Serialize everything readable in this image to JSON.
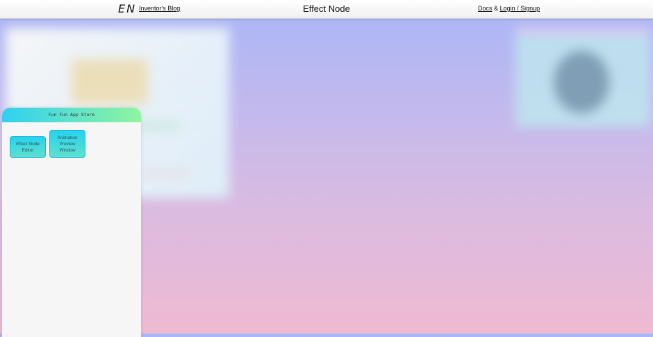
{
  "header": {
    "logo": "EN",
    "blog_link": "Inventor's Blog",
    "title": "Effect Node",
    "docs_link": "Docs",
    "ampersand": "&",
    "login_link": "Login / Signup"
  },
  "store": {
    "title": "Fun Fun App Store",
    "apps": [
      {
        "label": "Effect Node Editor"
      },
      {
        "label": "Animation Preview Window"
      }
    ]
  }
}
